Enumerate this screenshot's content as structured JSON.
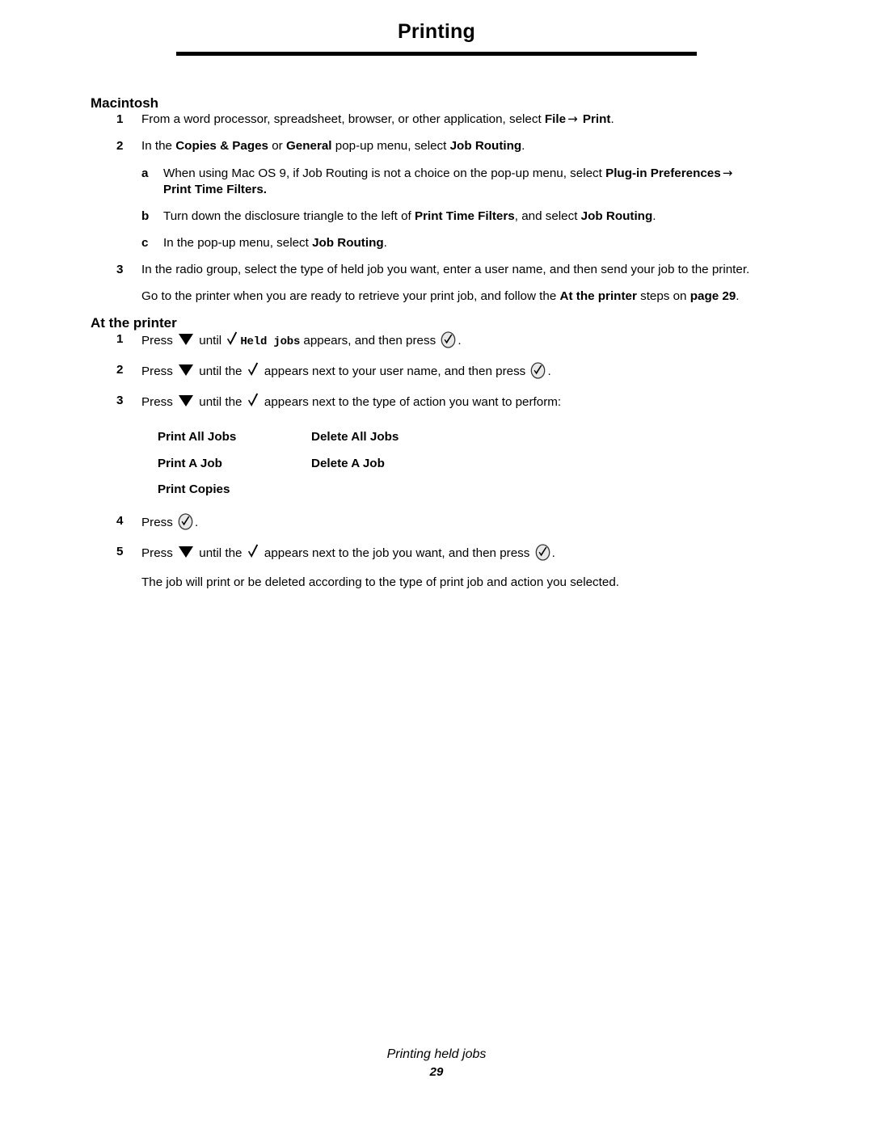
{
  "header": {
    "title": "Printing"
  },
  "macintosh": {
    "heading": "Macintosh",
    "steps": {
      "s1": {
        "marker": "1",
        "text_a": "From a word processor, spreadsheet, browser, or other application, select ",
        "bold_a": "File",
        "arrow": "→",
        "bold_b": "Print",
        "text_b": "."
      },
      "s2": {
        "marker": "2",
        "text_a": "In the ",
        "bold_a": "Copies & Pages",
        "text_b": " or ",
        "bold_b": "General",
        "text_c": " pop-up menu, select ",
        "bold_c": "Job Routing",
        "text_d": "."
      },
      "sa": {
        "marker": "a",
        "text_a": "When using Mac OS 9, if Job Routing is not a choice on the pop-up menu, select ",
        "bold_a": "Plug-in Preferences",
        "arrow": "→",
        "bold_b": "Print Time Filters."
      },
      "sb": {
        "marker": "b",
        "text_a": "Turn down the disclosure triangle to the left of ",
        "bold_a": "Print Time Filters",
        "text_b": ", and select ",
        "bold_b": "Job Routing",
        "text_c": "."
      },
      "sc": {
        "marker": "c",
        "text_a": "In the pop-up menu, select ",
        "bold_a": "Job Routing",
        "text_b": "."
      },
      "s3": {
        "marker": "3",
        "text_a": "In the radio group, select the type of held job you want, enter a user name, and then send your job to the printer."
      },
      "note": {
        "text_a": "Go to the printer when you are ready to retrieve your print job, and follow the ",
        "bold_a": "At the printer",
        "text_b": " steps on ",
        "bold_b": "page 29",
        "text_c": "."
      }
    }
  },
  "at_the_printer": {
    "heading": "At the printer",
    "steps": {
      "p1": {
        "marker": "1",
        "text_a": "Press ",
        "text_b": " until ",
        "screen_text": "Held jobs",
        "text_c": " appears, and then press ",
        "text_d": "."
      },
      "p2": {
        "marker": "2",
        "text_a": "Press ",
        "text_b": " until the ",
        "text_c": " appears next to your user name, and then press ",
        "text_d": "."
      },
      "p3": {
        "marker": "3",
        "text_a": "Press ",
        "text_b": " until the ",
        "text_c": " appears next to the type of action you want to perform:"
      },
      "p4": {
        "marker": "4",
        "text_a": "Press ",
        "text_b": "."
      },
      "p5": {
        "marker": "5",
        "text_a": "Press ",
        "text_b": " until the ",
        "text_c": " appears next to the job you want, and then press ",
        "text_d": "."
      },
      "note": {
        "text_a": "The job will print or be deleted according to the type of print job and action you selected."
      }
    },
    "actions": [
      {
        "print": "Print All Jobs",
        "delete": "Delete All Jobs"
      },
      {
        "print": "Print A Job",
        "delete": "Delete A Job"
      },
      {
        "print": "Print Copies",
        "delete": ""
      }
    ]
  },
  "footer": {
    "title": "Printing held jobs",
    "page_number": "29"
  },
  "icons": {
    "down_arrow": "down-triangle-icon",
    "check": "check-mark-icon",
    "select_button": "select-button-icon"
  },
  "colors": {
    "text": "#000000",
    "background": "#ffffff",
    "icon_fill": "#e8e8e8"
  }
}
